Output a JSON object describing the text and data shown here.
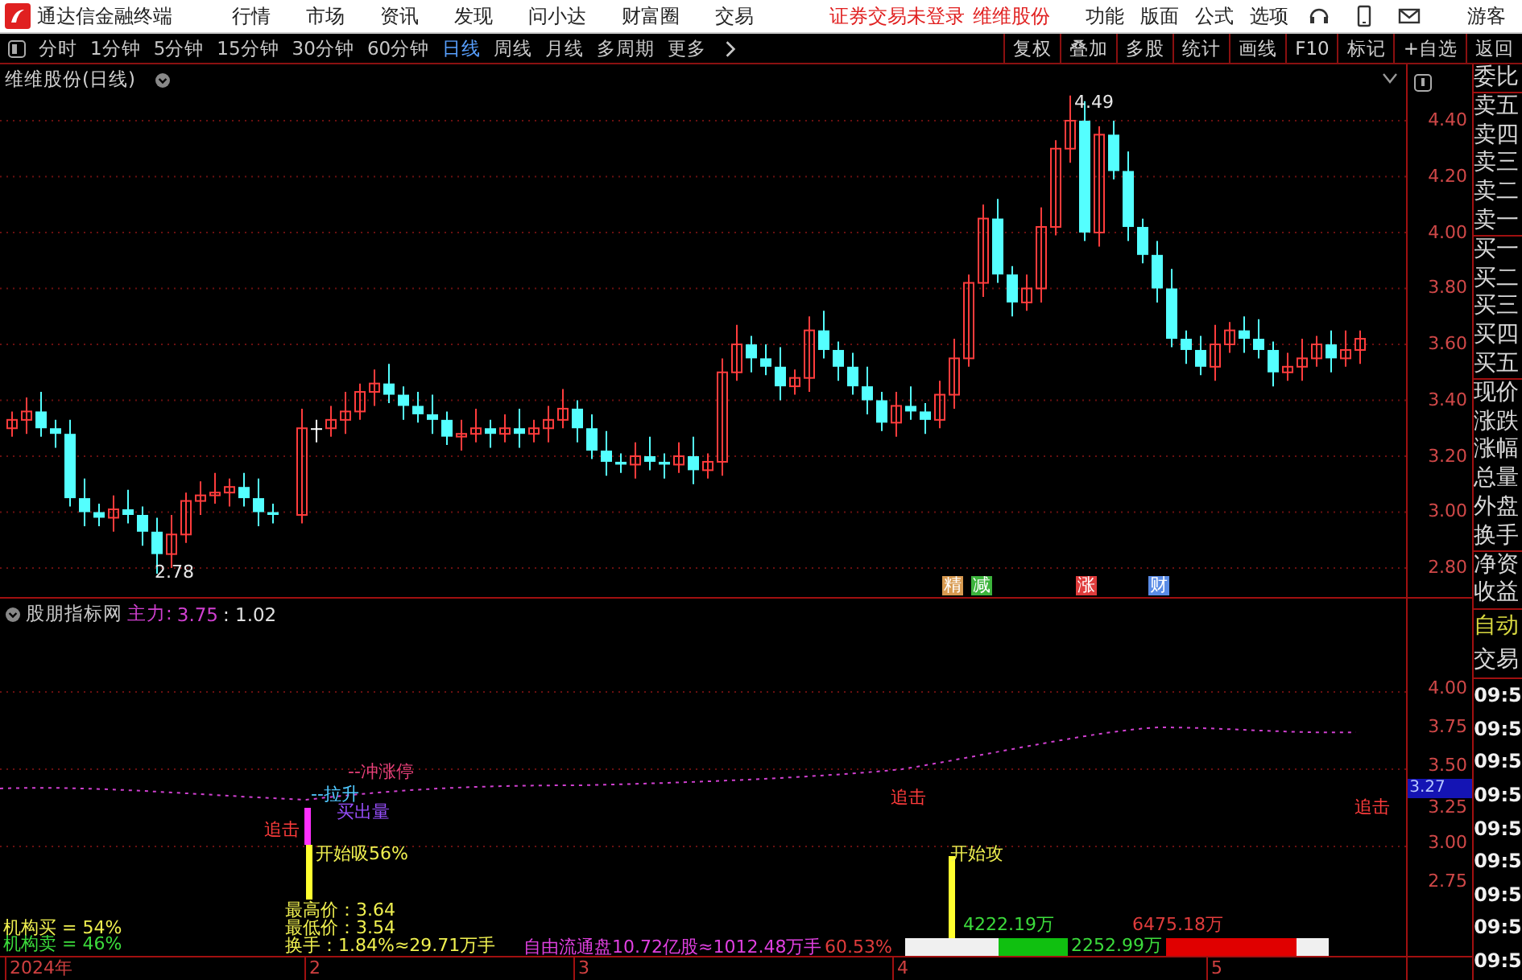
{
  "menu_bar": {
    "app_title": "通达信金融终端",
    "menus": [
      "行情",
      "市场",
      "资讯",
      "发现",
      "问小达",
      "财富圈",
      "交易"
    ],
    "notice": "证券交易未登录",
    "stock_link": "维维股份",
    "tools": [
      "功能",
      "版面",
      "公式",
      "选项"
    ],
    "user": "游客"
  },
  "toolbar": {
    "periods": [
      {
        "label": "分时",
        "selected": false
      },
      {
        "label": "1分钟",
        "selected": false
      },
      {
        "label": "5分钟",
        "selected": false
      },
      {
        "label": "15分钟",
        "selected": false
      },
      {
        "label": "30分钟",
        "selected": false
      },
      {
        "label": "60分钟",
        "selected": false
      },
      {
        "label": "日线",
        "selected": true
      },
      {
        "label": "周线",
        "selected": false
      },
      {
        "label": "月线",
        "selected": false
      },
      {
        "label": "多周期",
        "selected": false
      },
      {
        "label": "更多",
        "selected": false
      }
    ],
    "actions": [
      "复权",
      "叠加",
      "多股",
      "统计",
      "画线",
      "F10",
      "标记",
      "+自选",
      "返回"
    ]
  },
  "price_chart": {
    "title": "维维股份(日线)",
    "yticks": [
      "4.40",
      "4.20",
      "4.00",
      "3.80",
      "3.60",
      "3.40",
      "3.20",
      "3.00",
      "2.80"
    ],
    "high_label": "4.49",
    "low_label": "2.78",
    "event_marks": [
      {
        "label": "精",
        "color": "#d89a50"
      },
      {
        "label": "减",
        "color": "#3cb43c"
      },
      {
        "label": "涨",
        "color": "#e03c3c"
      },
      {
        "label": "财",
        "color": "#5a8ce6"
      }
    ]
  },
  "indicator": {
    "name": "股朋指标网",
    "main_label": "主力:",
    "main_value": "3.75",
    "ratio": ": 1.02",
    "yticks": [
      "4.00",
      "3.75",
      "3.50",
      "3.25",
      "3.00",
      "2.75"
    ],
    "current": "3.27",
    "annotations": [
      {
        "text": "--冲涨停",
        "color": "#e8407a"
      },
      {
        "text": "--拉升",
        "color": "#50c8ff"
      },
      {
        "text": "买出量",
        "color": "#9a50ff"
      },
      {
        "text": "追击",
        "color": "#ff3c3c"
      },
      {
        "text": "开始吸56%",
        "color": "#f0f050"
      },
      {
        "text": "机构买 = 54%",
        "color": "#f0f050"
      },
      {
        "text": "机构卖 = 46%",
        "color": "#3cdc3c"
      },
      {
        "text": "最高价：3.64",
        "color": "#f0f050"
      },
      {
        "text": "最低价：3.54",
        "color": "#f0f050"
      },
      {
        "text": "换手：1.84%≈29.71万手",
        "color": "#f0f050"
      },
      {
        "text": "自由流通盘10.72亿股≈1012.48万手",
        "color": "#e040e0"
      },
      {
        "text": "60.53%",
        "color": "#e03c3c"
      },
      {
        "text": "追击",
        "color": "#ff3c3c"
      },
      {
        "text": "开始攻",
        "color": "#f0f050"
      },
      {
        "text": "4222.19万",
        "color": "#3cdc3c"
      },
      {
        "text": "6475.18万",
        "color": "#e03c3c"
      },
      {
        "text": "追击",
        "color": "#ff3c3c"
      }
    ],
    "flow_value": "2252.99万"
  },
  "date_axis": [
    "2024年",
    "2",
    "3",
    "4",
    "5"
  ],
  "side_panel": {
    "quote_labels": [
      "委比",
      "卖五",
      "卖四",
      "卖三",
      "卖二",
      "卖一",
      "买一",
      "买二",
      "买三",
      "买四",
      "买五",
      "现价",
      "涨跌",
      "涨幅",
      "总量",
      "外盘",
      "换手",
      "净资",
      "收益"
    ],
    "auto_label": "自动",
    "trade_label": "交易",
    "times": [
      "09:5",
      "09:5",
      "09:5",
      "09:5",
      "09:5",
      "09:5",
      "09:5",
      "09:5",
      "09:5"
    ]
  }
}
